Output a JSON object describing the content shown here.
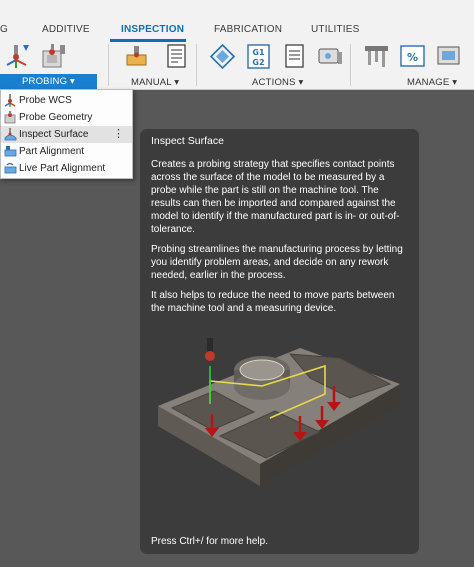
{
  "toolbar": {
    "tabs": [
      "G",
      "ADDITIVE",
      "INSPECTION",
      "FABRICATION",
      "UTILITIES"
    ],
    "active_tab": "INSPECTION",
    "groups": {
      "probing": "PROBING ▾",
      "manual": "MANUAL ▾",
      "actions": "ACTIONS ▾",
      "manage": "MANAGE ▾"
    },
    "g1g2_icon_text": [
      "G1",
      "G2"
    ],
    "accent_color": "#0d6fb8"
  },
  "probing_menu": {
    "items": [
      {
        "label": "Probe WCS",
        "icon": "probe-wcs-icon"
      },
      {
        "label": "Probe Geometry",
        "icon": "probe-geometry-icon"
      },
      {
        "label": "Inspect Surface",
        "icon": "inspect-surface-icon",
        "hovered": true
      },
      {
        "label": "Part Alignment",
        "icon": "part-alignment-icon"
      },
      {
        "label": "Live Part Alignment",
        "icon": "live-part-alignment-icon"
      }
    ],
    "kebab": "⋮"
  },
  "tooltip": {
    "title": "Inspect Surface",
    "paragraphs": [
      "Creates a probing strategy that specifies contact points across the surface of the model to be measured by a probe while the part is still on the machine tool. The results can then be imported and compared against the model to identify if the manufactured part is in- or out-of-tolerance.",
      "Probing streamlines the manufacturing process by letting you identify problem areas, and decide on any rework needed, earlier in the process.",
      "It also helps to reduce the need to move parts between the machine tool and a measuring device."
    ],
    "footer": "Press Ctrl+/ for more help."
  }
}
